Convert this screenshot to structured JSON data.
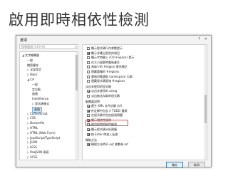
{
  "slide": {
    "title": "啟用即時相依性檢測"
  },
  "dialog": {
    "title": "選項",
    "help": "?",
    "close": "✕",
    "search_placeholder": "搜尋選項 (Ctrl+E)",
    "tree": [
      {
        "label": "文字編輯器",
        "expanded": true
      },
      {
        "label": "一般"
      },
      {
        "label": "檔案擴充"
      },
      {
        "label": "全部語言",
        "expanded": false
      },
      {
        "label": "Basic",
        "expanded": false
      },
      {
        "label": "C#",
        "expanded": true
      },
      {
        "label": "一般"
      },
      {
        "label": "定位點"
      },
      {
        "label": "進階"
      },
      {
        "label": "IntelliSense"
      },
      {
        "label": "程式碼樣式",
        "expanded": false
      },
      {
        "label": "進階",
        "selected": true
      },
      {
        "label": "CoffeeScript",
        "expanded": false
      },
      {
        "label": "CSS",
        "expanded": false
      },
      {
        "label": "Dockerfile",
        "expanded": false
      },
      {
        "label": "HTML",
        "expanded": false
      },
      {
        "label": "HTML (Web Form)",
        "expanded": false
      },
      {
        "label": "JavaScript/TypeScript",
        "expanded": false
      },
      {
        "label": "JSON",
        "expanded": false
      },
      {
        "label": "LESS",
        "expanded": false
      },
      {
        "label": "PeaJSON 資源",
        "expanded": false
      },
      {
        "label": "SCSS",
        "expanded": false
      }
    ],
    "options": [
      {
        "label": "顯示程式碼行內參數提示",
        "checked": false
      },
      {
        "label": "顯示非匯出型別的項目",
        "checked": true
      },
      {
        "label": "顯示字串輸入 (Ctrl+Space) 提示",
        "checked": false
      },
      {
        "label": "在大小變更時重新產生",
        "checked": false
      },
      {
        "label": "為缺少的 #region 增添標記",
        "checked": false
      },
      {
        "label": "隱藏重複的 #regions",
        "checked": false
      },
      {
        "label": "重新對應選取 namespace 大綱",
        "checked": false
      },
      {
        "label": "隱藏程式碼區塊 #regions",
        "checked": false
      }
    ],
    "group_fade": "淡出未使用的程式碼",
    "fade_options": [
      {
        "label": "淡出未使用的 using",
        "checked": true
      },
      {
        "label": "淡出無法存取的程式碼",
        "checked": false
      }
    ],
    "group_editor": "編輯器說明",
    "editor_options": [
      {
        "label": "產生 XML 文件註解 (///)",
        "checked": true
      },
      {
        "label": "於註解中包含 // TODO 選項",
        "checked": true
      },
      {
        "label": "在程式碼中包含偵測問題",
        "checked": false
      },
      {
        "label": "顯示相依性檢測",
        "checked": true
      },
      {
        "label": "啟用即時相依性檢測",
        "checked": true
      },
      {
        "label": "顯示程式碼分析建議",
        "checked": true
      },
      {
        "label": "按 Enter 時加入括號",
        "checked": true
      }
    ],
    "group_nav": "擷取方法",
    "nav_options": [
      {
        "label": "擷取方法時不 out 參數為 ref",
        "checked": true
      }
    ],
    "ok": "確定",
    "cancel": "取消"
  }
}
